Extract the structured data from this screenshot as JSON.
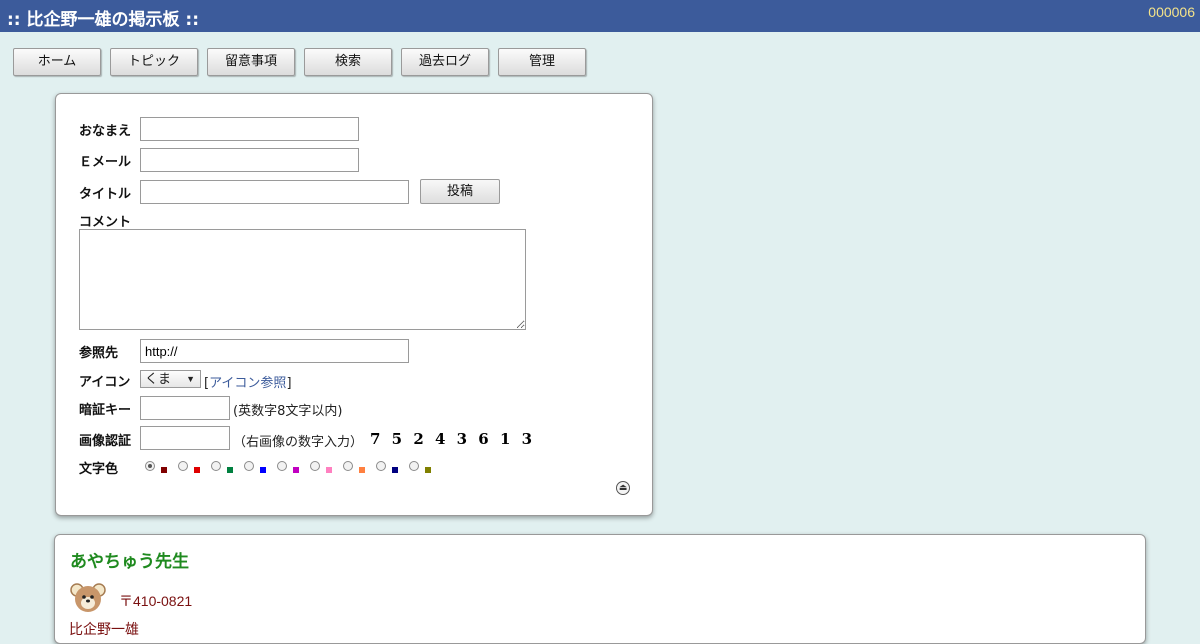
{
  "header": {
    "title": ":: 比企野一雄の掲示板 ::",
    "counter": "000006"
  },
  "nav": [
    {
      "label": "ホーム"
    },
    {
      "label": "トピック"
    },
    {
      "label": "留意事項"
    },
    {
      "label": "検索"
    },
    {
      "label": "過去ログ"
    },
    {
      "label": "管理"
    }
  ],
  "form": {
    "name_label": "おなまえ",
    "email_label": "Ｅメール",
    "title_label": "タイトル",
    "submit_label": "投稿",
    "comment_label": "コメント",
    "url_label": "参照先",
    "url_value": "http://",
    "icon_label": "アイコン",
    "icon_selected": "くま",
    "icon_ref_open": "[",
    "icon_ref_link": "アイコン参照",
    "icon_ref_close": "]",
    "password_label": "暗証キー",
    "password_note": "(英数字8文字以内)",
    "captcha_label": "画像認証",
    "captcha_note": "（右画像の数字入力）",
    "captcha_digits": "7 5 2 4 3 6 1 3",
    "color_label": "文字色",
    "colors": [
      "#800000",
      "#df0000",
      "#008040",
      "#0000ff",
      "#c100c1",
      "#ff80c0",
      "#ff8040",
      "#000080",
      "#808000"
    ],
    "selected_color_index": 0
  },
  "post": {
    "title": "あやちゅう先生",
    "text": "〒410-0821",
    "author": "比企野一雄"
  }
}
